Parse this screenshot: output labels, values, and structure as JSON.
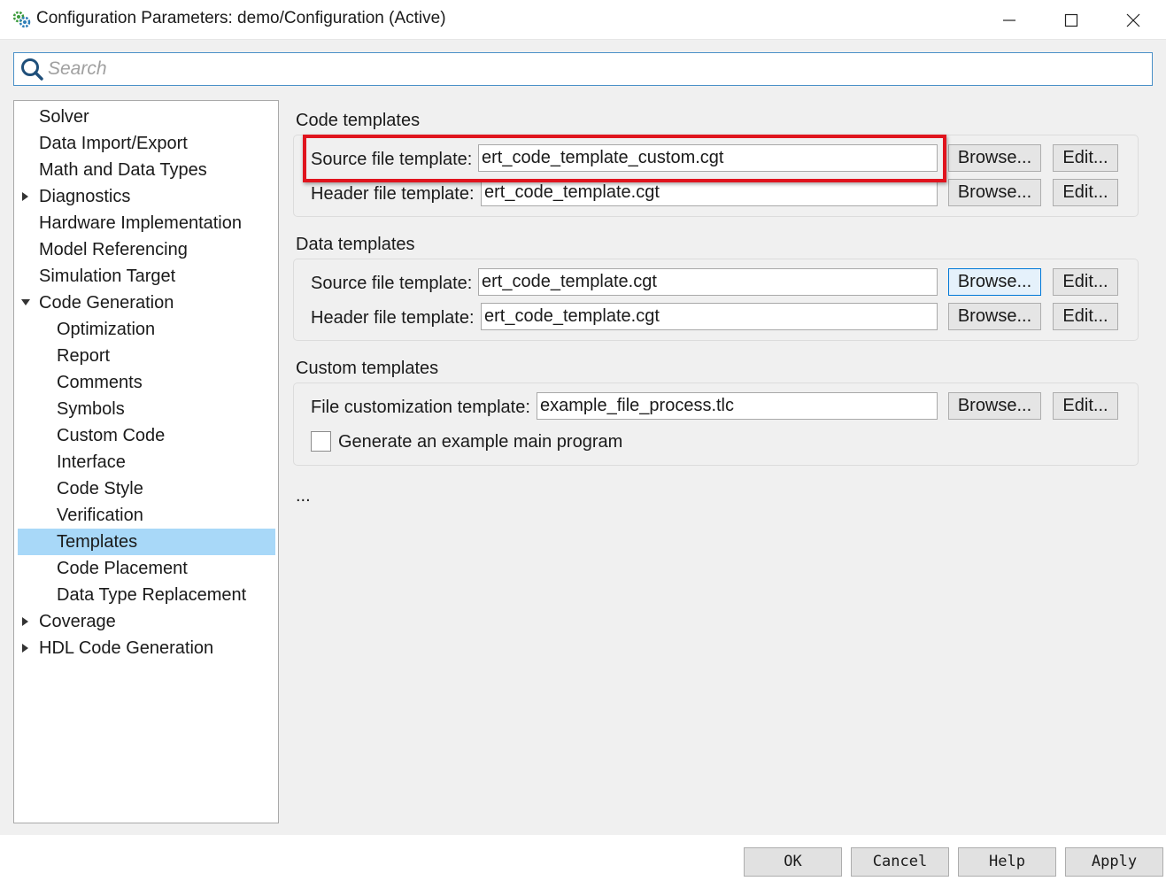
{
  "window": {
    "title": "Configuration Parameters: demo/Configuration (Active)",
    "app_icon": "gear-cluster-icon",
    "controls": [
      "minimize-icon",
      "maximize-icon",
      "close-icon"
    ]
  },
  "search": {
    "placeholder": "Search",
    "value": ""
  },
  "tree": {
    "selected": "Templates",
    "items": [
      {
        "label": "Solver",
        "level": 0,
        "expander": "none"
      },
      {
        "label": "Data Import/Export",
        "level": 0,
        "expander": "none"
      },
      {
        "label": "Math and Data Types",
        "level": 0,
        "expander": "none"
      },
      {
        "label": "Diagnostics",
        "level": 0,
        "expander": "collapsed"
      },
      {
        "label": "Hardware Implementation",
        "level": 0,
        "expander": "none"
      },
      {
        "label": "Model Referencing",
        "level": 0,
        "expander": "none"
      },
      {
        "label": "Simulation Target",
        "level": 0,
        "expander": "none"
      },
      {
        "label": "Code Generation",
        "level": 0,
        "expander": "expanded"
      },
      {
        "label": "Optimization",
        "level": 1,
        "expander": "none"
      },
      {
        "label": "Report",
        "level": 1,
        "expander": "none"
      },
      {
        "label": "Comments",
        "level": 1,
        "expander": "none"
      },
      {
        "label": "Symbols",
        "level": 1,
        "expander": "none"
      },
      {
        "label": "Custom Code",
        "level": 1,
        "expander": "none"
      },
      {
        "label": "Interface",
        "level": 1,
        "expander": "none"
      },
      {
        "label": "Code Style",
        "level": 1,
        "expander": "none"
      },
      {
        "label": "Verification",
        "level": 1,
        "expander": "none"
      },
      {
        "label": "Templates",
        "level": 1,
        "expander": "none"
      },
      {
        "label": "Code Placement",
        "level": 1,
        "expander": "none"
      },
      {
        "label": "Data Type Replacement",
        "level": 1,
        "expander": "none"
      },
      {
        "label": "Coverage",
        "level": 0,
        "expander": "collapsed"
      },
      {
        "label": "HDL Code Generation",
        "level": 0,
        "expander": "collapsed"
      }
    ]
  },
  "code_templates": {
    "title": "Code templates",
    "source_label": "Source file template:",
    "source_value": "ert_code_template_custom.cgt",
    "header_label": "Header file template:",
    "header_value": "ert_code_template.cgt"
  },
  "data_templates": {
    "title": "Data templates",
    "source_label": "Source file template:",
    "source_value": "ert_code_template.cgt",
    "header_label": "Header file template:",
    "header_value": "ert_code_template.cgt"
  },
  "custom_templates": {
    "title": "Custom templates",
    "file_label": "File customization template:",
    "file_value": "example_file_process.tlc",
    "checkbox_label": "Generate an example main program",
    "checkbox_checked": false
  },
  "buttons": {
    "browse": "Browse...",
    "edit": "Edit..."
  },
  "more_indicator": "...",
  "footer": {
    "ok": "OK",
    "cancel": "Cancel",
    "help": "Help",
    "apply": "Apply"
  },
  "colors": {
    "selection": "#a8d8f8",
    "highlight_border": "#e0141e",
    "search_border": "#4a90c8",
    "panel_background": "#f0f0f0"
  }
}
